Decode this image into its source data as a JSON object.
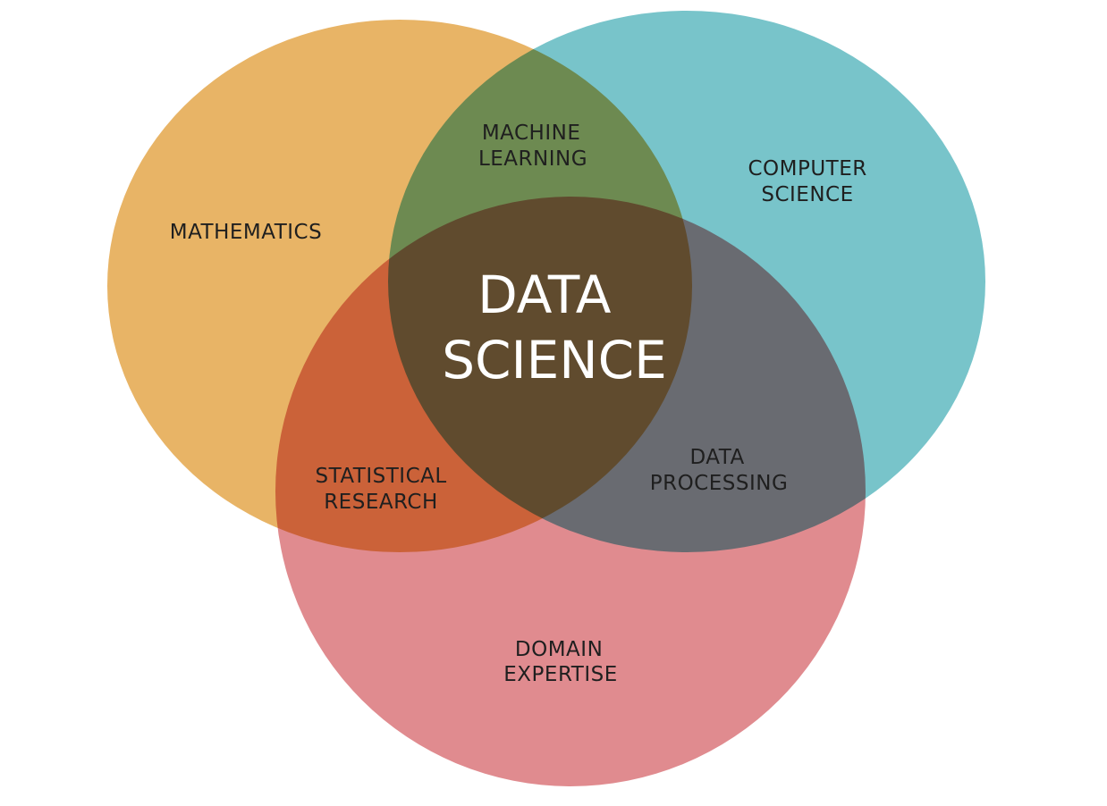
{
  "sets": [
    {
      "id": "mathematics",
      "label": [
        "MATHEMATICS"
      ],
      "color": "#e8b466"
    },
    {
      "id": "computer-science",
      "label": [
        "COMPUTER",
        "SCIENCE"
      ],
      "color": "#78c4ca"
    },
    {
      "id": "domain-expertise",
      "label": [
        "DOMAIN",
        "EXPERTISE"
      ],
      "color": "#e08b8f"
    }
  ],
  "intersections": {
    "machine_learning": [
      "MACHINE",
      "LEARNING"
    ],
    "statistical_research": [
      "STATISTICAL",
      "RESEARCH"
    ],
    "data_processing": [
      "DATA",
      "PROCESSING"
    ]
  },
  "center": [
    "DATA",
    "SCIENCE"
  ],
  "colors": {
    "background": "#ffffff",
    "label_text": "#1f1f1f",
    "center_text": "#ffffff"
  }
}
